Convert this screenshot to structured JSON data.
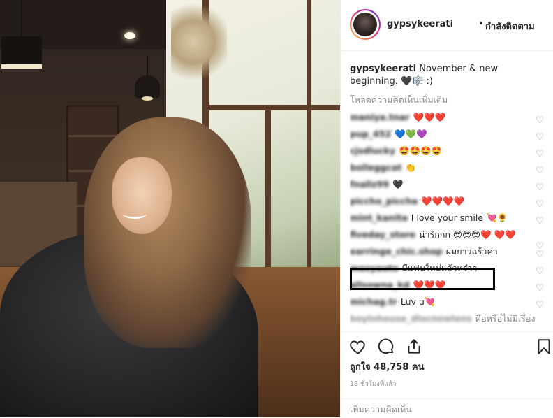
{
  "header": {
    "username": "gypsykeerati",
    "separator": "•",
    "follow_status": "กำลังติดตาม"
  },
  "caption": {
    "username": "gypsykeerati",
    "text": "November & new beginning. 🖤🎼 :)"
  },
  "load_more": "โหลดความคิดเห็นเพิ่มเติม",
  "comments": [
    {
      "user": "maniya.tnar",
      "text": "❤️❤️❤️"
    },
    {
      "user": "pup_452",
      "text": "💙💚💜"
    },
    {
      "user": "cjsdlucky",
      "text": "🤩🤩🤩🤩"
    },
    {
      "user": "bolleggcat",
      "text": "👏"
    },
    {
      "user": "fnallz99",
      "text": "🖤"
    },
    {
      "user": "piccho_piccha",
      "text": "❤️❤️❤️❤️"
    },
    {
      "user": "mint_kanita",
      "text": "I love your smile 💘🌻"
    },
    {
      "user": "fiveday_store",
      "text": "น่ารักกก 😎😎😎❤️ ❤️❤️"
    },
    {
      "user": "earringe_chic.shop",
      "text": "ผมยาวแร้วค่า"
    },
    {
      "user": "maxyauto",
      "text": "มีแฟนใหม่แล้วหร๋าา"
    },
    {
      "user": "allsowna_kd",
      "text": "❤️❤️❤️"
    },
    {
      "user": "michag.tr",
      "text": "Luv u💘"
    },
    {
      "user": "boylnhouse_dlocnowlens",
      "text": "คือหรือไม่มีเรื่อง"
    }
  ],
  "likes": "ถูกใจ 48,758 คน",
  "timestamp": "18 ชั่วโมงที่แล้ว",
  "add_comment": {
    "placeholder": "เพิ่มความคิดเห็น"
  },
  "colors": {
    "border": "#efefef",
    "secondary_text": "#8e8e8e",
    "primary_text": "#262626"
  },
  "icons": [
    "like-heart-icon",
    "comment-icon",
    "share-icon",
    "save-bookmark-icon",
    "comment-like-icon"
  ]
}
